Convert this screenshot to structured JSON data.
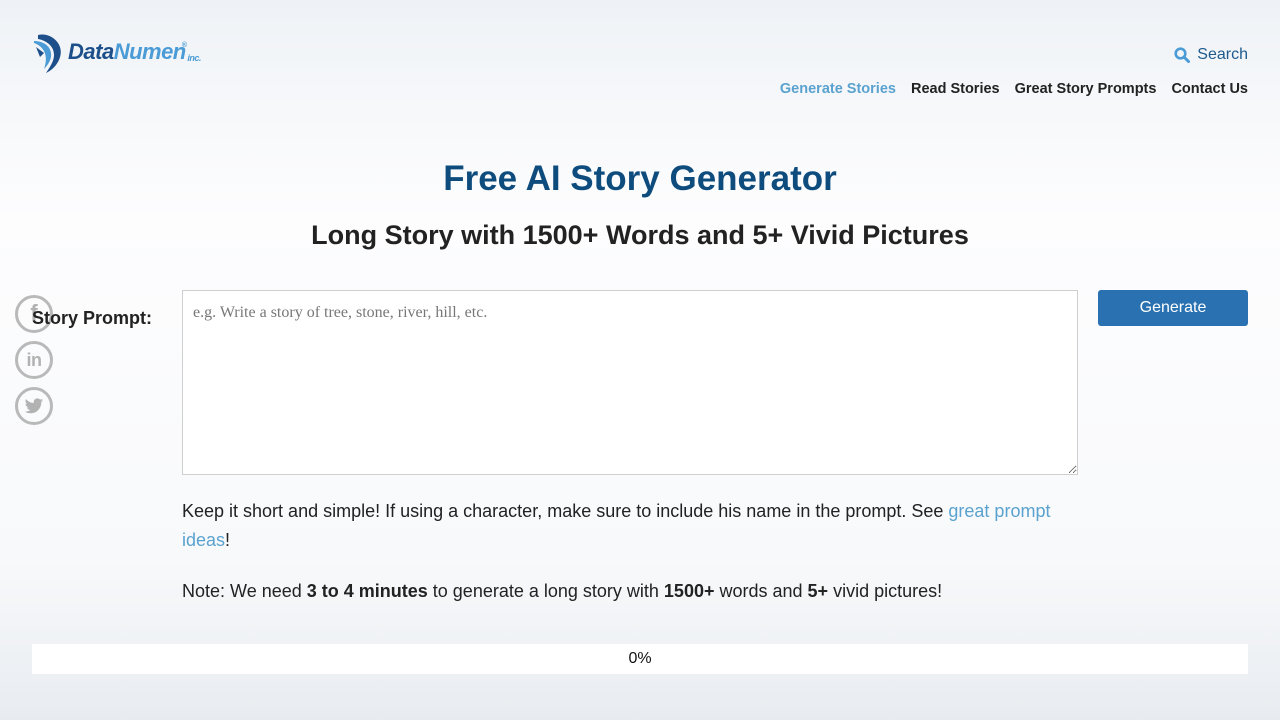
{
  "header": {
    "logo": {
      "primary": "Data",
      "secondary": "Numen",
      "suffix": "inc.",
      "registered": "®"
    },
    "search_label": "Search",
    "nav": [
      {
        "label": "Generate Stories",
        "active": true
      },
      {
        "label": "Read Stories",
        "active": false
      },
      {
        "label": "Great Story Prompts",
        "active": false
      },
      {
        "label": "Contact Us",
        "active": false
      }
    ]
  },
  "main": {
    "title": "Free AI Story Generator",
    "subtitle": "Long Story with 1500+ Words and 5+ Vivid Pictures",
    "prompt_label": "Story Prompt:",
    "prompt_value": "",
    "prompt_placeholder": "e.g. Write a story of tree, stone, river, hill, etc.",
    "generate_label": "Generate",
    "hint": {
      "text": "Keep it short and simple! If using a character, make sure to include his name in the prompt. See ",
      "link": "great prompt ideas",
      "end": "!"
    },
    "note": {
      "p1": "Note: We need ",
      "b1": "3 to 4 minutes",
      "p2": " to generate a long story with ",
      "b2": "1500+",
      "p3": " words and ",
      "b3": "5+",
      "p4": " vivid pictures!"
    },
    "progress": {
      "percent": 0,
      "label": "0%"
    }
  },
  "social": [
    {
      "name": "facebook",
      "glyph": "f"
    },
    {
      "name": "linkedin",
      "glyph": "in"
    },
    {
      "name": "twitter",
      "glyph": "twitter-bird"
    }
  ],
  "colors": {
    "brand_dark": "#0f4c7e",
    "accent_link": "#5aa2cf",
    "button": "#2a71b1"
  }
}
